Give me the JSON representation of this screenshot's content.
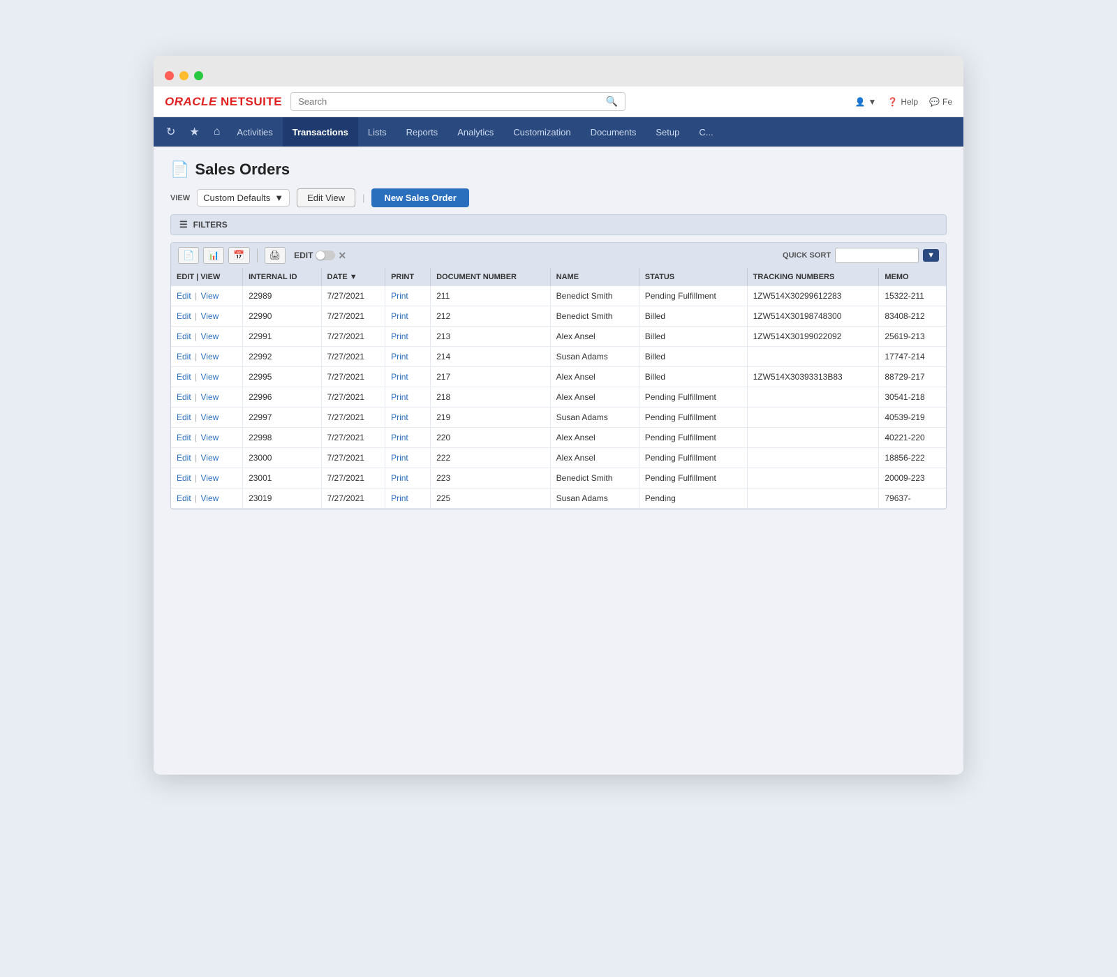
{
  "browser": {
    "dots": [
      "red",
      "yellow",
      "green"
    ]
  },
  "topbar": {
    "logo": "ORACLE NETSUITE",
    "search_placeholder": "Search",
    "icons_right": [
      {
        "name": "user-icon",
        "label": ""
      },
      {
        "name": "help-icon",
        "label": "Help"
      },
      {
        "name": "chat-icon",
        "label": "Fe"
      }
    ]
  },
  "navbar": {
    "icons": [
      "history-icon",
      "favorites-icon",
      "home-icon"
    ],
    "items": [
      {
        "label": "Activities",
        "active": false
      },
      {
        "label": "Transactions",
        "active": true
      },
      {
        "label": "Lists",
        "active": false
      },
      {
        "label": "Reports",
        "active": false
      },
      {
        "label": "Analytics",
        "active": false
      },
      {
        "label": "Customization",
        "active": false
      },
      {
        "label": "Documents",
        "active": false
      },
      {
        "label": "Setup",
        "active": false
      },
      {
        "label": "C...",
        "active": false
      }
    ]
  },
  "page": {
    "title": "Sales Orders",
    "view_label": "VIEW",
    "view_option": "Custom Defaults",
    "btn_edit_view": "Edit View",
    "btn_new_order": "New Sales Order",
    "filters_label": "FILTERS"
  },
  "table_toolbar": {
    "edit_label": "EDIT",
    "quick_sort_label": "QUICK SORT"
  },
  "table": {
    "columns": [
      "EDIT | VIEW",
      "INTERNAL ID",
      "DATE ▼",
      "PRINT",
      "DOCUMENT NUMBER",
      "NAME",
      "STATUS",
      "TRACKING NUMBERS",
      "MEMO"
    ],
    "rows": [
      {
        "edit": "Edit",
        "view": "View",
        "internal_id": "22989",
        "date": "7/27/2021",
        "print": "Print",
        "doc_number": "211",
        "name": "Benedict Smith",
        "status": "Pending Fulfillment",
        "tracking": "1ZW514X30299612283",
        "memo": "15322-211"
      },
      {
        "edit": "Edit",
        "view": "View",
        "internal_id": "22990",
        "date": "7/27/2021",
        "print": "Print",
        "doc_number": "212",
        "name": "Benedict Smith",
        "status": "Billed",
        "tracking": "1ZW514X30198748300",
        "memo": "83408-212"
      },
      {
        "edit": "Edit",
        "view": "View",
        "internal_id": "22991",
        "date": "7/27/2021",
        "print": "Print",
        "doc_number": "213",
        "name": "Alex Ansel",
        "status": "Billed",
        "tracking": "1ZW514X30199022092",
        "memo": "25619-213"
      },
      {
        "edit": "Edit",
        "view": "View",
        "internal_id": "22992",
        "date": "7/27/2021",
        "print": "Print",
        "doc_number": "214",
        "name": "Susan Adams",
        "status": "Billed",
        "tracking": "",
        "memo": "17747-214"
      },
      {
        "edit": "Edit",
        "view": "View",
        "internal_id": "22995",
        "date": "7/27/2021",
        "print": "Print",
        "doc_number": "217",
        "name": "Alex Ansel",
        "status": "Billed",
        "tracking": "1ZW514X30393313B83",
        "memo": "88729-217"
      },
      {
        "edit": "Edit",
        "view": "View",
        "internal_id": "22996",
        "date": "7/27/2021",
        "print": "Print",
        "doc_number": "218",
        "name": "Alex Ansel",
        "status": "Pending Fulfillment",
        "tracking": "",
        "memo": "30541-218"
      },
      {
        "edit": "Edit",
        "view": "View",
        "internal_id": "22997",
        "date": "7/27/2021",
        "print": "Print",
        "doc_number": "219",
        "name": "Susan Adams",
        "status": "Pending Fulfillment",
        "tracking": "",
        "memo": "40539-219"
      },
      {
        "edit": "Edit",
        "view": "View",
        "internal_id": "22998",
        "date": "7/27/2021",
        "print": "Print",
        "doc_number": "220",
        "name": "Alex Ansel",
        "status": "Pending Fulfillment",
        "tracking": "",
        "memo": "40221-220"
      },
      {
        "edit": "Edit",
        "view": "View",
        "internal_id": "23000",
        "date": "7/27/2021",
        "print": "Print",
        "doc_number": "222",
        "name": "Alex Ansel",
        "status": "Pending Fulfillment",
        "tracking": "",
        "memo": "18856-222"
      },
      {
        "edit": "Edit",
        "view": "View",
        "internal_id": "23001",
        "date": "7/27/2021",
        "print": "Print",
        "doc_number": "223",
        "name": "Benedict Smith",
        "status": "Pending Fulfillment",
        "tracking": "",
        "memo": "20009-223"
      },
      {
        "edit": "Edit",
        "view": "View",
        "internal_id": "23019",
        "date": "7/27/2021",
        "print": "Print",
        "doc_number": "225",
        "name": "Susan Adams",
        "status": "Pending",
        "tracking": "",
        "memo": "79637-"
      }
    ]
  }
}
